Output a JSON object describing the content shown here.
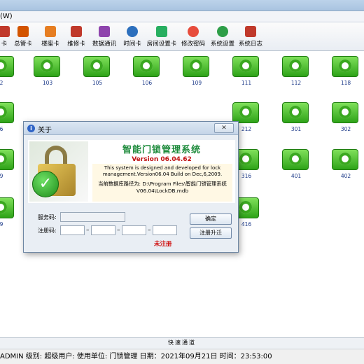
{
  "window": {
    "menu_fragment": "(W)"
  },
  "toolbar": [
    {
      "label": "卡",
      "icon": "card-icon",
      "color": "#c0392b"
    },
    {
      "label": "总管卡",
      "icon": "master-card-icon",
      "color": "#d35400"
    },
    {
      "label": "楼座卡",
      "icon": "building-card-icon",
      "color": "#e67e22"
    },
    {
      "label": "维修卡",
      "icon": "repair-card-icon",
      "color": "#c0392b"
    },
    {
      "label": "数据通讯",
      "icon": "data-comm-icon",
      "color": "#8e44ad"
    },
    {
      "label": "时间卡",
      "icon": "clock-icon",
      "color": "#2c6fbd"
    },
    {
      "label": "房间设置卡",
      "icon": "room-setting-icon",
      "color": "#27ae60"
    },
    {
      "label": "修改密码",
      "icon": "users-icon",
      "color": "#e74c3c"
    },
    {
      "label": "系统设置",
      "icon": "settings-icon",
      "color": "#2e9e48"
    },
    {
      "label": "系统日志",
      "icon": "log-icon",
      "color": "#c0392b"
    }
  ],
  "rooms": [
    {
      "number": "2"
    },
    {
      "number": "103"
    },
    {
      "number": "105"
    },
    {
      "number": "106"
    },
    {
      "number": "109"
    },
    {
      "number": "111"
    },
    {
      "number": "112"
    },
    {
      "number": "118"
    },
    {
      "number": "6"
    },
    {
      "number": "212"
    },
    {
      "number": "301"
    },
    {
      "number": "302"
    },
    {
      "number": "9"
    },
    {
      "number": "316"
    },
    {
      "number": "401"
    },
    {
      "number": "402"
    },
    {
      "number": "9"
    },
    {
      "number": "416"
    },
    {
      "number": ""
    },
    {
      "number": ""
    },
    {
      "number": ""
    },
    {
      "number": ""
    }
  ],
  "dialog": {
    "title": "关于",
    "close_label": "✕",
    "app_name": "智能门锁管理系统",
    "version": "Version 06.04.62",
    "description": "This system is designed and developed for lock management.Version06.04 Build on Dec,6,2009.",
    "db_path": "当前数据库路径为: D:\\Program Files\\智能门锁管理系统V06.04\\LockDB.mdb",
    "service_code_label": "服务码:",
    "service_code_value": "",
    "reg_code_label": "注册码:",
    "reg_code_parts": [
      "",
      "",
      "",
      ""
    ],
    "status": "未注册",
    "ok_label": "确定",
    "upgrade_label": "注册升迁"
  },
  "quick_channel": "快速通道",
  "status_bar": "ADMIN 级别: 超级用户: 使用单位: 门锁管理 日期：2021年09月21日 时间：23:53:00"
}
